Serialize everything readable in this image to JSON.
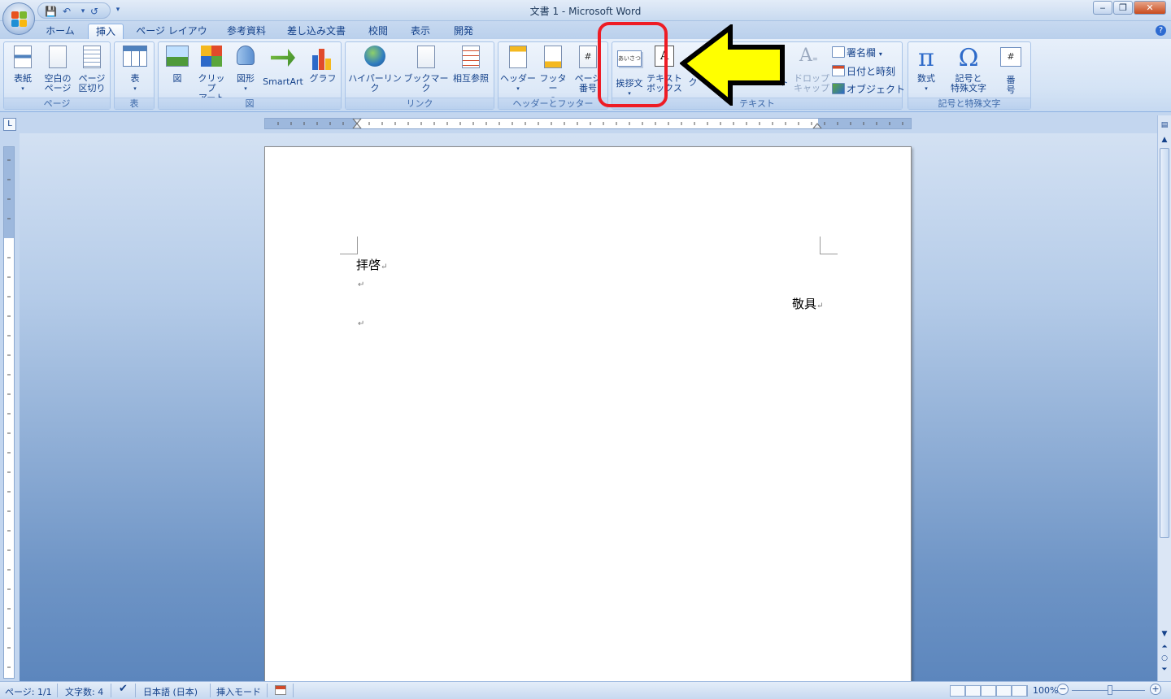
{
  "window": {
    "title": "文書 1 - Microsoft Word",
    "controls": {
      "minimize": "‒",
      "maximize": "❐",
      "close": "✕"
    }
  },
  "quick_access": {
    "save": "💾",
    "undo": "↶",
    "redo": "↺",
    "more": "▾"
  },
  "tabs": [
    "ホーム",
    "挿入",
    "ページ レイアウト",
    "参考資料",
    "差し込み文書",
    "校閲",
    "表示",
    "開発"
  ],
  "active_tab": "挿入",
  "ribbon": {
    "page_group": {
      "label": "ページ",
      "cover": "表紙",
      "blank_page": [
        "空白の",
        "ページ"
      ],
      "page_break": [
        "ページ",
        "区切り"
      ]
    },
    "table_group": {
      "label": "表",
      "table": "表"
    },
    "illustrations_group": {
      "label": "図",
      "picture": "図",
      "clipart": [
        "クリップ",
        "アート"
      ],
      "shapes": "図形",
      "smartart": "SmartArt",
      "chart": "グラフ"
    },
    "links_group": {
      "label": "リンク",
      "hyperlink": "ハイパーリンク",
      "bookmark": "ブックマーク",
      "cross_ref": "相互参照"
    },
    "header_footer_group": {
      "label": "ヘッダーとフッター",
      "header": "ヘッダー",
      "footer": "フッター",
      "page_number": [
        "ページ",
        "番号"
      ]
    },
    "text_group": {
      "label": "テキスト",
      "greeting": "挨拶文",
      "greeting_icon_text": "あいさつ",
      "textbox": [
        "テキスト",
        "ボックス"
      ],
      "quickparts_partial": "ク",
      "wordart_partial": "ト",
      "dropcap": [
        "ドロップ",
        "キャップ"
      ],
      "signature": "署名欄",
      "datetime": "日付と時刻",
      "object": "オブジェクト"
    },
    "symbols_group": {
      "label": "記号と特殊文字",
      "equation": "数式",
      "symbol": [
        "記号と",
        "特殊文字"
      ],
      "number": [
        "番",
        "号"
      ]
    }
  },
  "ruler": {
    "corner": "L"
  },
  "document": {
    "line1": "拝啓",
    "closing": "敬具",
    "para_mark": "↵"
  },
  "statusbar": {
    "page": "ページ: 1/1",
    "word_count": "文字数: 4",
    "language": "日本語 (日本)",
    "mode": "挿入モード",
    "zoom": "100%"
  },
  "annotations": {
    "highlight_color": "#ee1c25",
    "arrow_color": "#ffff00"
  }
}
